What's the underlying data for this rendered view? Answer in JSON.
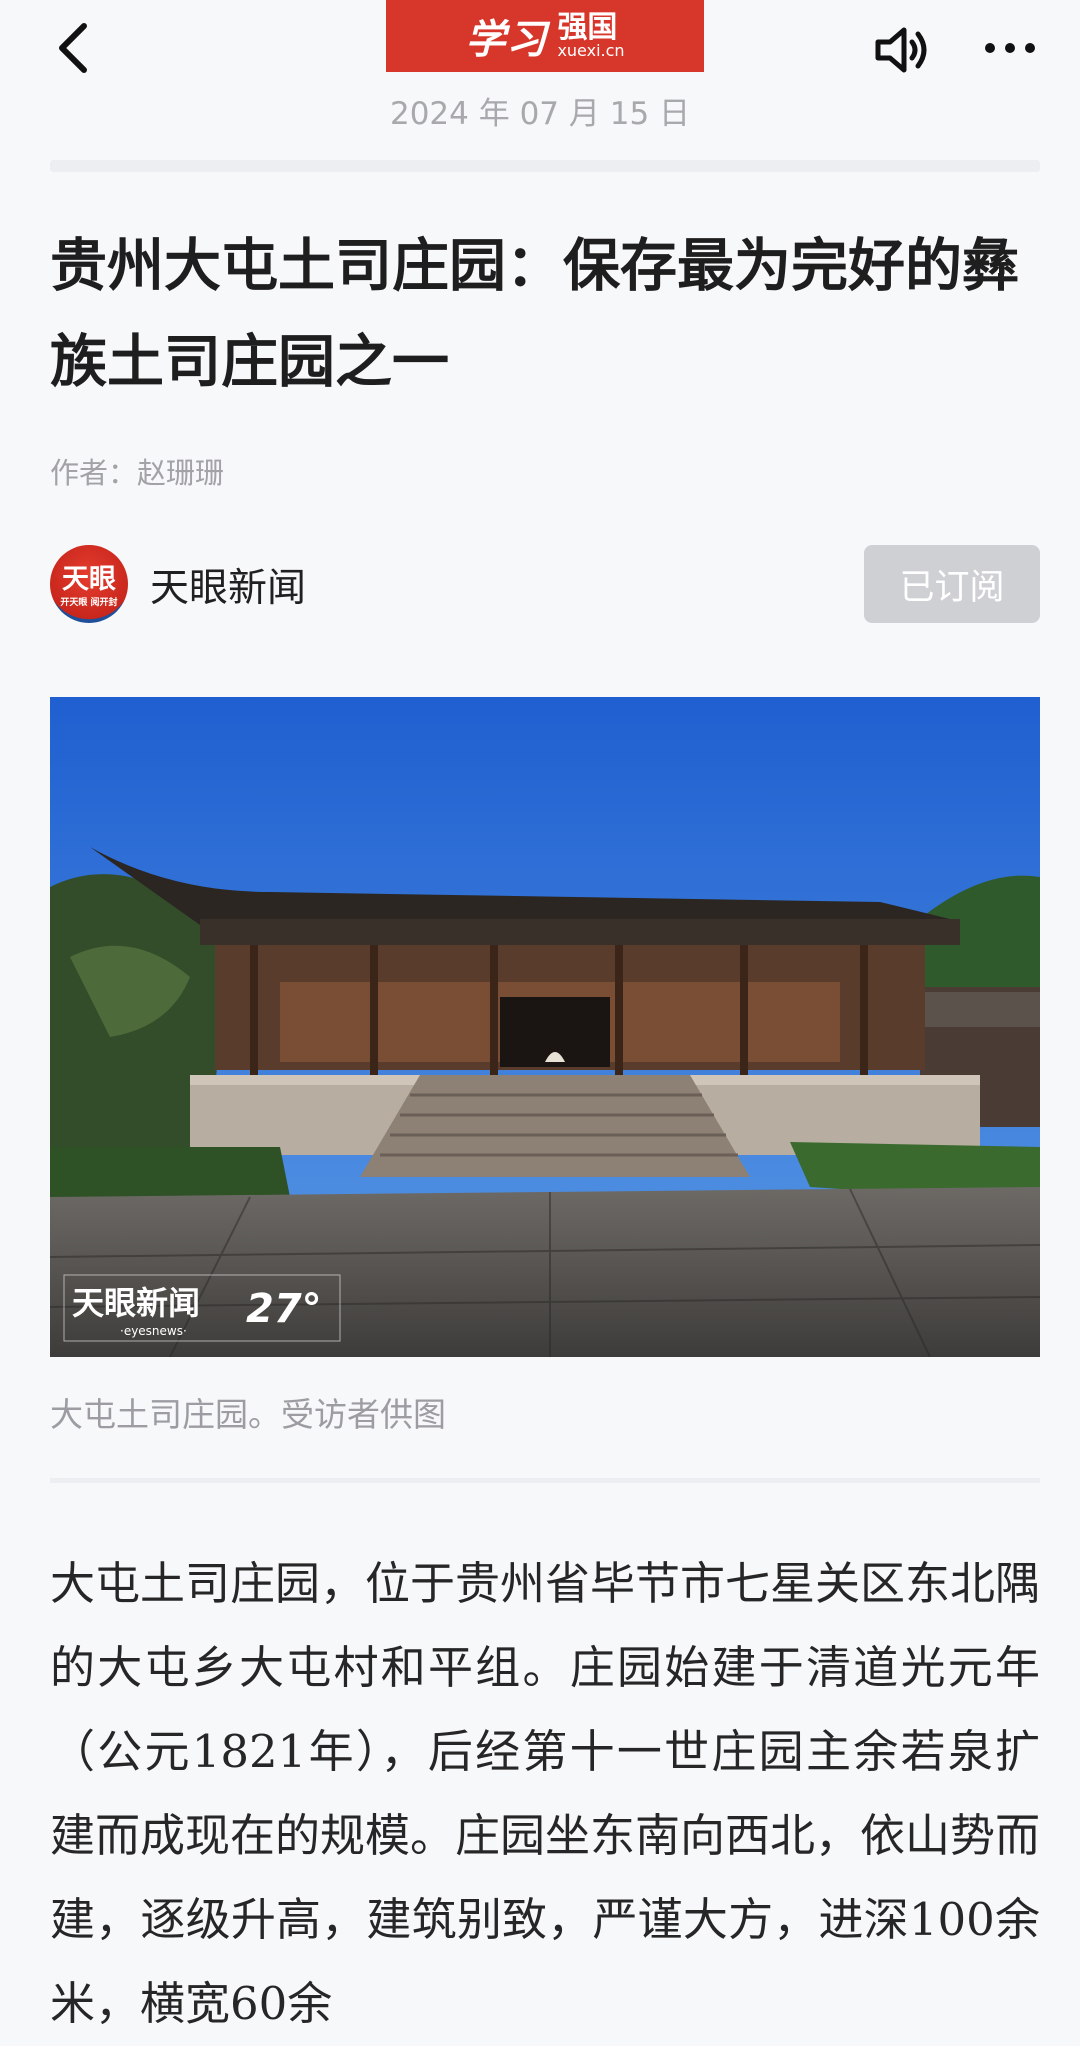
{
  "header": {
    "logo_main": "学习",
    "logo_cn": "强国",
    "logo_url": "xuexi.cn",
    "date": "2024 年 07 月 15 日"
  },
  "article": {
    "title": "贵州大屯土司庄园：保存最为完好的彝族土司庄园之一",
    "author": "作者：赵珊珊",
    "source": {
      "avatar_text": "天眼",
      "avatar_sub": "开天眼 阅开封",
      "name": "天眼新闻",
      "subscribe_label": "已订阅"
    },
    "image": {
      "watermark": "天眼新闻",
      "watermark_sub": "·eyesnews·",
      "watermark_num": "27°"
    },
    "caption": "大屯土司庄园。受访者供图",
    "body": "大屯土司庄园，位于贵州省毕节市七星关区东北隅的大屯乡大屯村和平组。庄园始建于清道光元年（公元1821年），后经第十一世庄园主余若泉扩建而成现在的规模。庄园坐东南向西北，依山势而建，逐级升高，建筑别致，严谨大方，进深100余米，横宽60余"
  },
  "colors": {
    "accent_red": "#d7362b",
    "subscribe_bg": "#cfd0d3",
    "page_bg": "#f7f8fa"
  },
  "icons": [
    "back-arrow-icon",
    "speaker-icon",
    "more-icon"
  ]
}
